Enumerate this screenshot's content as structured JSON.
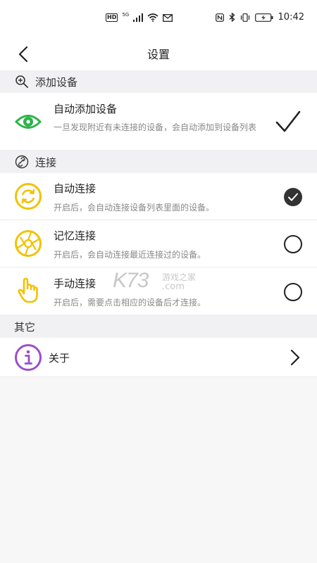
{
  "status_bar": {
    "hd": "HD",
    "network": "5G",
    "time": "10:42"
  },
  "header": {
    "title": "设置"
  },
  "sections": {
    "add_device": {
      "label": "添加设备",
      "icon": "search-plus-icon",
      "items": [
        {
          "title": "自动添加设备",
          "desc": "一旦发现附近有未连接的设备，会自动添加到设备列表",
          "icon": "eye-icon",
          "checked": true
        }
      ]
    },
    "connect": {
      "label": "连接",
      "icon": "link-icon",
      "items": [
        {
          "title": "自动连接",
          "desc": "开启后，会自动连接设备列表里面的设备。",
          "icon": "refresh-icon",
          "selected": true
        },
        {
          "title": "记忆连接",
          "desc": "开启后，会自动连接最近连接过的设备。",
          "icon": "aperture-icon",
          "selected": false
        },
        {
          "title": "手动连接",
          "desc": "开启后，需要点击相应的设备后才连接。",
          "icon": "hand-pointer-icon",
          "selected": false
        }
      ]
    },
    "other": {
      "label": "其它",
      "items": [
        {
          "title": "关于",
          "icon": "info-icon"
        }
      ]
    }
  },
  "watermark": {
    "brand": "K73",
    "sub": "游戏之家",
    "domain": ".com"
  },
  "colors": {
    "green": "#2fb34a",
    "yellow": "#f2c200",
    "purple": "#9b4dca",
    "section_bg": "#f1f1f3"
  }
}
